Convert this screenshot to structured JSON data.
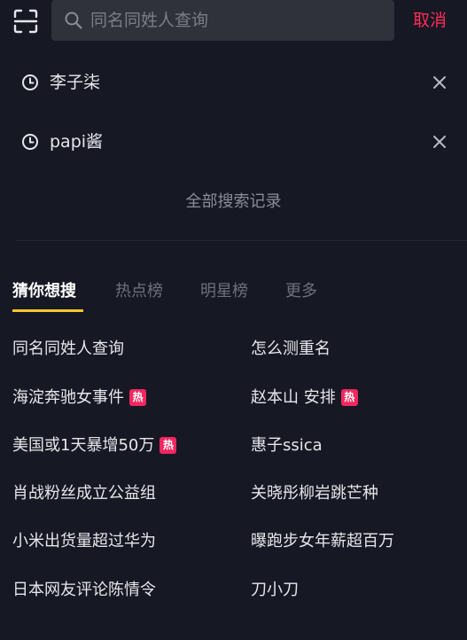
{
  "search": {
    "placeholder": "同名同姓人查询",
    "cancel_label": "取消"
  },
  "history": [
    {
      "label": "李子柒",
      "icon": "clock-icon"
    },
    {
      "label": "papi酱",
      "icon": "clock-icon"
    }
  ],
  "all_history_label": "全部搜索记录",
  "tabs": [
    {
      "label": "猜你想搜",
      "active": true
    },
    {
      "label": "热点榜",
      "active": false
    },
    {
      "label": "明星榜",
      "active": false
    },
    {
      "label": "更多",
      "active": false
    }
  ],
  "hot_badge": "热",
  "suggestions": [
    {
      "text": "同名同姓人查询",
      "hot": false
    },
    {
      "text": "怎么测重名",
      "hot": false
    },
    {
      "text": "海淀奔驰女事件",
      "hot": true
    },
    {
      "text": "赵本山 安排",
      "hot": true
    },
    {
      "text": "美国或1天暴增50万",
      "hot": true
    },
    {
      "text": "惠子ssica",
      "hot": false
    },
    {
      "text": "肖战粉丝成立公益组",
      "hot": false
    },
    {
      "text": "关晓彤柳岩跳芒种",
      "hot": false
    },
    {
      "text": "小米出货量超过华为",
      "hot": false
    },
    {
      "text": "曝跑步女年薪超百万",
      "hot": false
    },
    {
      "text": "日本网友评论陈情令",
      "hot": false
    },
    {
      "text": "刀小刀",
      "hot": false
    }
  ],
  "colors": {
    "background": "#161824",
    "accent_cancel": "#fe2c55",
    "tab_underline": "#f7c52c",
    "hot_badge": "#f2275f"
  }
}
